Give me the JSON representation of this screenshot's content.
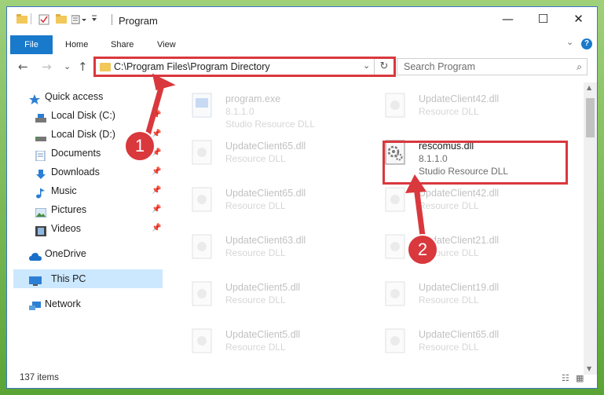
{
  "window": {
    "title": "Program",
    "controls": {
      "minimize": "—",
      "maximize": "☐",
      "close": "✕"
    }
  },
  "ribbon": {
    "tabs": [
      "File",
      "Home",
      "Share",
      "View"
    ],
    "collapse_glyph": "⌄",
    "help_glyph": "?"
  },
  "address": {
    "path": "C:\\Program Files\\Program Directory",
    "dropdown_glyph": "⌄",
    "refresh_glyph": "↻"
  },
  "search": {
    "placeholder": "Search Program",
    "icon": "search-icon"
  },
  "nav": {
    "back": "←",
    "forward": "→",
    "recent": "⌄",
    "up": "↑"
  },
  "sidebar": {
    "items": [
      {
        "label": "Quick access",
        "icon": "star-icon",
        "pinned": false
      },
      {
        "label": "Local Disk (C:)",
        "icon": "drive-icon",
        "pinned": true
      },
      {
        "label": "Local Disk (D:)",
        "icon": "drive-icon",
        "pinned": true
      },
      {
        "label": "Documents",
        "icon": "documents-icon",
        "pinned": true
      },
      {
        "label": "Downloads",
        "icon": "downloads-icon",
        "pinned": true
      },
      {
        "label": "Music",
        "icon": "music-icon",
        "pinned": true
      },
      {
        "label": "Pictures",
        "icon": "pictures-icon",
        "pinned": true
      },
      {
        "label": "Videos",
        "icon": "videos-icon",
        "pinned": true
      },
      {
        "label": "OneDrive",
        "icon": "cloud-icon",
        "pinned": false
      },
      {
        "label": "This PC",
        "icon": "computer-icon",
        "pinned": false,
        "selected": true
      },
      {
        "label": "Network",
        "icon": "network-icon",
        "pinned": false
      }
    ],
    "pin_glyph": "📌"
  },
  "files": [
    {
      "name": "program.exe",
      "version": "8.1.1.0",
      "desc": "Studio Resource DLL"
    },
    {
      "name": "UpdateClient42.dll",
      "version": "",
      "desc": "Resource DLL"
    },
    {
      "name": "UpdateClient65.dll",
      "version": "",
      "desc": "Resource DLL"
    },
    {
      "name": "rescomus.dll",
      "version": "8.1.1.0",
      "desc": "Studio Resource DLL"
    },
    {
      "name": "UpdateClient65.dll",
      "version": "",
      "desc": "Resource DLL"
    },
    {
      "name": "UpdateClient42.dll",
      "version": "",
      "desc": "Resource DLL"
    },
    {
      "name": "UpdateClient63.dll",
      "version": "",
      "desc": "Resource DLL"
    },
    {
      "name": "UpdateClient21.dll",
      "version": "",
      "desc": "Resource DLL"
    },
    {
      "name": "UpdateClient5.dll",
      "version": "",
      "desc": "Resource DLL"
    },
    {
      "name": "UpdateClient19.dll",
      "version": "",
      "desc": "Resource DLL"
    },
    {
      "name": "UpdateClient5.dll",
      "version": "",
      "desc": "Resource DLL"
    },
    {
      "name": "UpdateClient65.dll",
      "version": "",
      "desc": "Resource DLL"
    }
  ],
  "status": {
    "item_count": "137 items"
  },
  "callouts": [
    "1",
    "2"
  ],
  "colors": {
    "accent": "#1979ca",
    "highlight": "#d9383d",
    "selected": "#cce8ff"
  }
}
